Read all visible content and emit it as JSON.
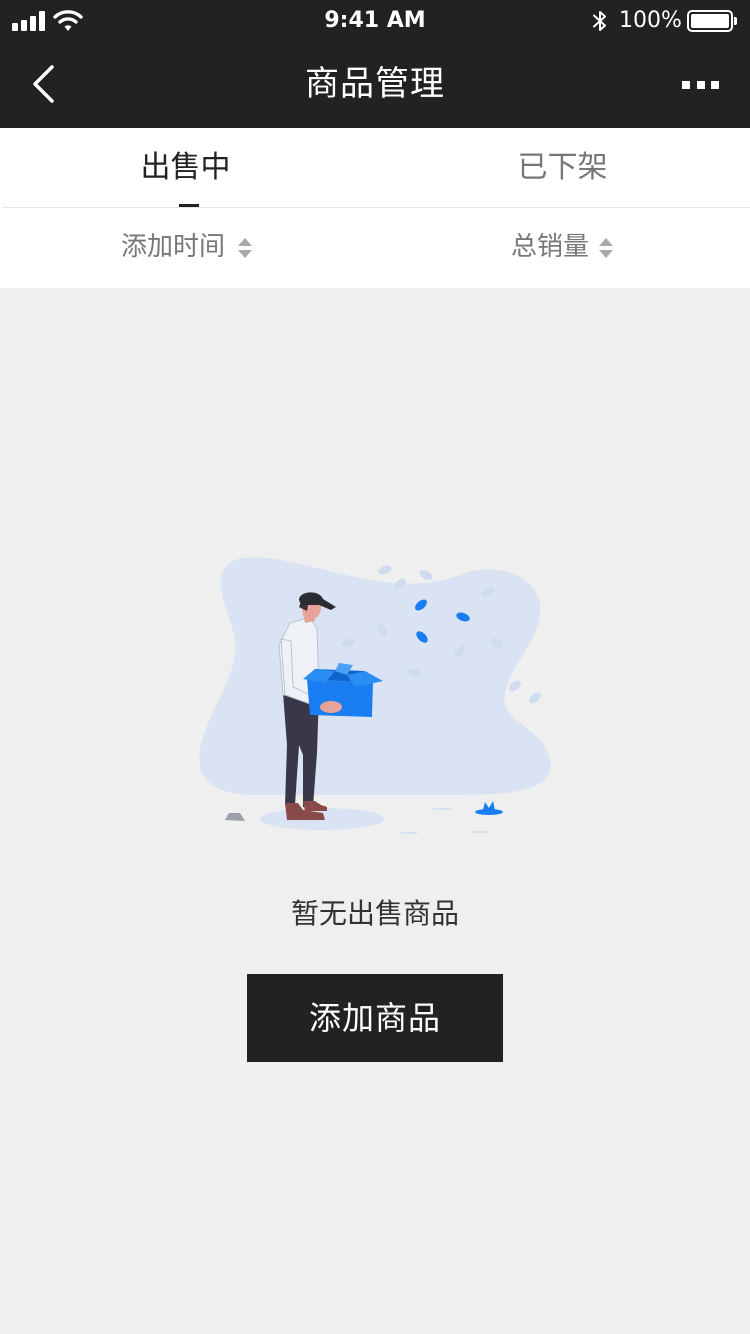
{
  "status_bar": {
    "time": "9:41 AM",
    "battery_text": "100%",
    "battery_level": 1.0,
    "signal_bars": 4,
    "icons": [
      "signal-icon",
      "wifi-icon",
      "bluetooth-icon",
      "battery-icon"
    ]
  },
  "nav": {
    "title": "商品管理",
    "back_icon": "chevron-left-icon",
    "more_icon": "more-dots-icon"
  },
  "tabs": [
    {
      "label": "出售中",
      "active": true
    },
    {
      "label": "已下架",
      "active": false
    }
  ],
  "sort": [
    {
      "label": "添加时间",
      "icon": "sort-arrows-icon"
    },
    {
      "label": "总销量",
      "icon": "sort-arrows-icon"
    }
  ],
  "empty_state": {
    "illustration": "empty-box-illustration",
    "message": "暂无出售商品",
    "button_label": "添加商品"
  },
  "colors": {
    "header_bg": "#222222",
    "page_bg": "#efefef",
    "accent_blue": "#1a7ef2",
    "illustration_blob": "#dae3f3",
    "button_bg": "#222222"
  }
}
